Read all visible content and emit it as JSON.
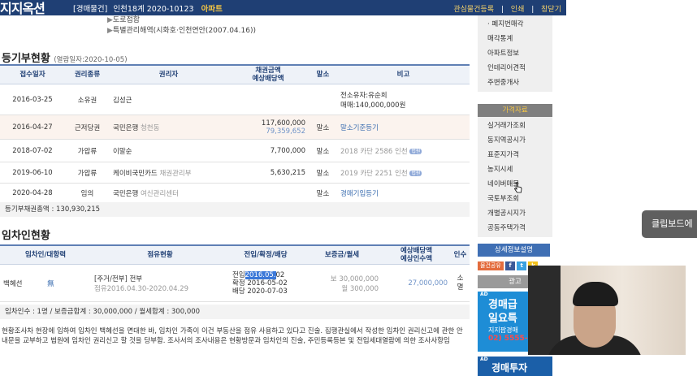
{
  "header": {
    "logo": "지지옥션",
    "category": "[경매물건]",
    "case": "인천18계 2020-10123",
    "type": "아파트",
    "links": [
      "관심물건등록",
      "인쇄",
      "창닫기"
    ],
    "separators": [
      "|",
      "|"
    ]
  },
  "info_lines": [
    "도로접함",
    "특별관리해역(시화호·인천연안(2007.04.16))"
  ],
  "registry": {
    "title": "등기부현황",
    "viewed": "(열람일자:2020-10-05)",
    "headers": [
      "접수일자",
      "권리종류",
      "권리자",
      "채권금액\n예상배당액",
      "말소",
      "비고"
    ],
    "rows": [
      {
        "date": "2016-03-25",
        "kind": "소유권",
        "holder": "김성근",
        "holder_sub": "",
        "amount": "",
        "expected": "",
        "cancel": "",
        "note": "전소유자:유순희",
        "note2": "매매:140,000,000원",
        "tag": ""
      },
      {
        "date": "2016-04-27",
        "kind": "근저당권",
        "holder": "국민은행",
        "holder_sub": "청천동",
        "amount": "117,600,000",
        "expected": "79,359,652",
        "cancel": "말소",
        "note": "말소기준등기",
        "note2": "",
        "tag": ""
      },
      {
        "date": "2018-07-02",
        "kind": "가압류",
        "holder": "이말순",
        "holder_sub": "",
        "amount": "7,700,000",
        "expected": "",
        "cancel": "말소",
        "note": "2018 카단 2586 인천",
        "note2": "",
        "tag": "법원"
      },
      {
        "date": "2019-06-10",
        "kind": "가압류",
        "holder": "케이비국민카드",
        "holder_sub": "채권관리부",
        "amount": "5,630,215",
        "expected": "",
        "cancel": "말소",
        "note": "2019 카단 2251 인천",
        "note2": "",
        "tag": "법원"
      },
      {
        "date": "2020-04-28",
        "kind": "임의",
        "holder": "국민은행",
        "holder_sub": "여신관리센터",
        "amount": "",
        "expected": "",
        "cancel": "말소",
        "note": "경매기입등기",
        "note2": "",
        "tag": ""
      }
    ],
    "total": "등기부채권총액 : 130,930,215"
  },
  "tenants": {
    "title": "임차인현황",
    "headers": [
      "임차인/대항력",
      "점유현황",
      "전입/확정/배당",
      "보증금/월세",
      "예상배당액\n예상인수액",
      "인수"
    ],
    "row": {
      "name": "백혜선",
      "mark": "無",
      "occupancy": "[주거/전부] 전부",
      "period": "점유2016.04.30-2020.04.29",
      "move_in_prefix": "전입",
      "move_in_hl": "2016.05.",
      "move_in_suffix": "02",
      "confirmed": "확정 2016-05-02",
      "dividend": "배당 2020-07-03",
      "deposit": "보 30,000,000",
      "rent": "월 300,000",
      "expected": "27,000,000",
      "takeover": "소\n멸"
    },
    "summary": "임차인수 : 1명 / 보증금합계 : 30,000,000 / 월세합계 : 300,000",
    "note": "현황조사차 현장에 임하여 임차인 백혜선을 면대한 바, 임차인 가족이 이건 부동산을 점유 사용하고 있다고 진술. 집행관실에서 작성한 임차인 권리신고에 관한 안내문을 교부하고 법원에 임차인 권리신고 할 것을 당부함. 조사서의 조사내용은 현황방문과 임차인의 진술, 주민등록등본 및 전입세대열람에 의한 조사사항임"
  },
  "sidebar": {
    "top_items": [
      "· 폐지번매각",
      "매각통계",
      "아파트정보",
      "인테리어견적",
      "주변중개사"
    ],
    "price_header": "가격자료",
    "price_items": [
      "실거래가조회",
      "동지역공시가",
      "표준지가격",
      "농지시세",
      "네이버매물",
      "국토부조회",
      "개별공시지가",
      "공동주택가격"
    ],
    "detail_button": "상세정보설명",
    "share_label": "물건공유",
    "share_icons": [
      "f",
      "t",
      "k"
    ],
    "ad_header": "광고",
    "ad_small": "AD",
    "ad1": [
      "경매급",
      "일요특",
      "지지팝경매",
      "02) 5555-"
    ],
    "ad2": "경매투자"
  },
  "clipboard": "클립보드에"
}
